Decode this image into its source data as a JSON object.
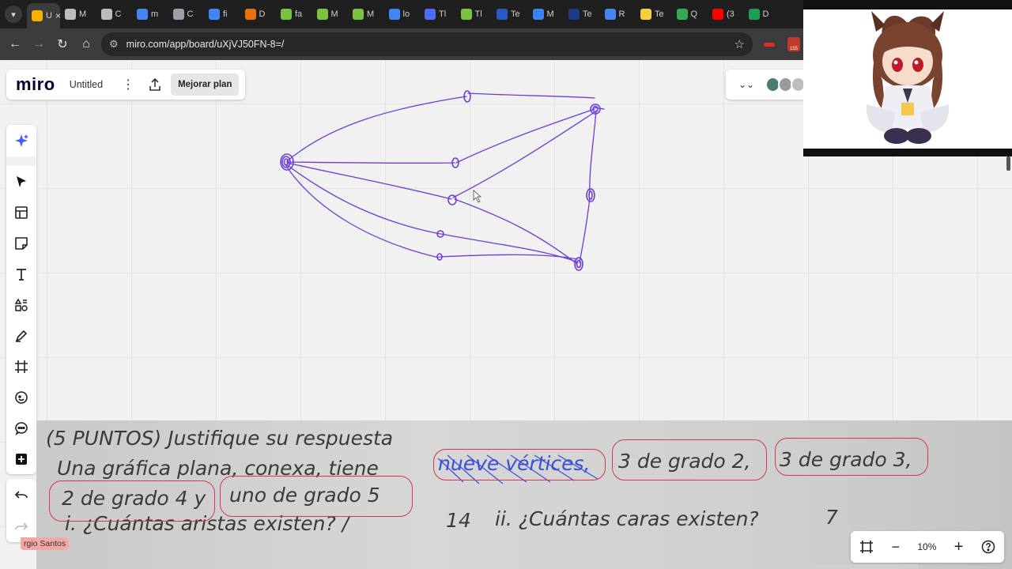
{
  "browser": {
    "tabs": [
      {
        "label": "U",
        "active": true,
        "color": "#f6b100"
      },
      {
        "label": "M",
        "color": "#bbbbbb"
      },
      {
        "label": "C",
        "color": "#bbbbbb"
      },
      {
        "label": "m",
        "color": "#4285f4"
      },
      {
        "label": "C",
        "color": "#9aa0a6"
      },
      {
        "label": "fi",
        "color": "#4285f4"
      },
      {
        "label": "D",
        "color": "#e8710a"
      },
      {
        "label": "fa",
        "color": "#7cc142"
      },
      {
        "label": "M",
        "color": "#7cc142"
      },
      {
        "label": "M",
        "color": "#7cc142"
      },
      {
        "label": "lo",
        "color": "#4285f4"
      },
      {
        "label": "Tl",
        "color": "#4a6cf7"
      },
      {
        "label": "Tl",
        "color": "#7cc142"
      },
      {
        "label": "Te",
        "color": "#2b59c3"
      },
      {
        "label": "M",
        "color": "#3b82f6"
      },
      {
        "label": "Te",
        "color": "#1e3a8a"
      },
      {
        "label": "R",
        "color": "#4285f4"
      },
      {
        "label": "Te",
        "color": "#f4d03f"
      },
      {
        "label": "Q",
        "color": "#34a853"
      },
      {
        "label": "(3",
        "color": "#ff0000"
      },
      {
        "label": "D",
        "color": "#1f9d55"
      }
    ],
    "tab_close": "×",
    "url": "miro.com/app/board/uXjVJ50FN-8=/",
    "ext_badge": "155"
  },
  "board": {
    "logo": "miro",
    "title": "Untitled",
    "upgrade_label": "Mejorar plan",
    "zoom": "10%"
  },
  "collaborator": {
    "cursor_name": "rgio Santos"
  },
  "photo_text": {
    "line1": "(5 PUNTOS) Justifique su respuesta",
    "line2a": "Una gráfica plana, conexa, tiene",
    "line2b": "nueve vértices,",
    "line2c": "3 de grado 2,",
    "line2d": "3 de grado 3,",
    "line3a": "2 de grado 4 y",
    "line3b": "uno de grado 5",
    "line4a": "i.   ¿Cuántas aristas existen? /",
    "line4b": "14",
    "line4c": "ii.  ¿Cuántas caras existen?",
    "line4d": "7"
  },
  "icons": {
    "tab_dropdown": "chevron-down-icon",
    "back": "arrow-left-icon",
    "forward": "arrow-right-icon",
    "reload": "reload-icon",
    "home": "home-icon",
    "site_settings": "tune-icon",
    "bookmark": "star-icon",
    "menu": "kebab-icon",
    "share": "share-icon",
    "collapse": "chevron-double-down-icon",
    "ai": "sparkle-icon",
    "select": "cursor-icon",
    "templates": "layout-icon",
    "sticky": "sticky-note-icon",
    "text": "text-icon",
    "shapes": "shapes-icon",
    "pen": "pen-icon",
    "frame": "frame-icon",
    "emoji": "emoji-icon",
    "comment": "comment-icon",
    "add": "plus-square-icon",
    "undo": "undo-icon",
    "redo": "redo-icon",
    "fit": "fit-screen-icon",
    "zoom_out": "minus-icon",
    "zoom_in": "plus-icon",
    "help": "help-icon"
  },
  "colors": {
    "pen": "#6a3fd4",
    "ink_circle": "#d23a4a",
    "ink_scribble": "#3b4fd8",
    "accent": "#4262ff"
  }
}
